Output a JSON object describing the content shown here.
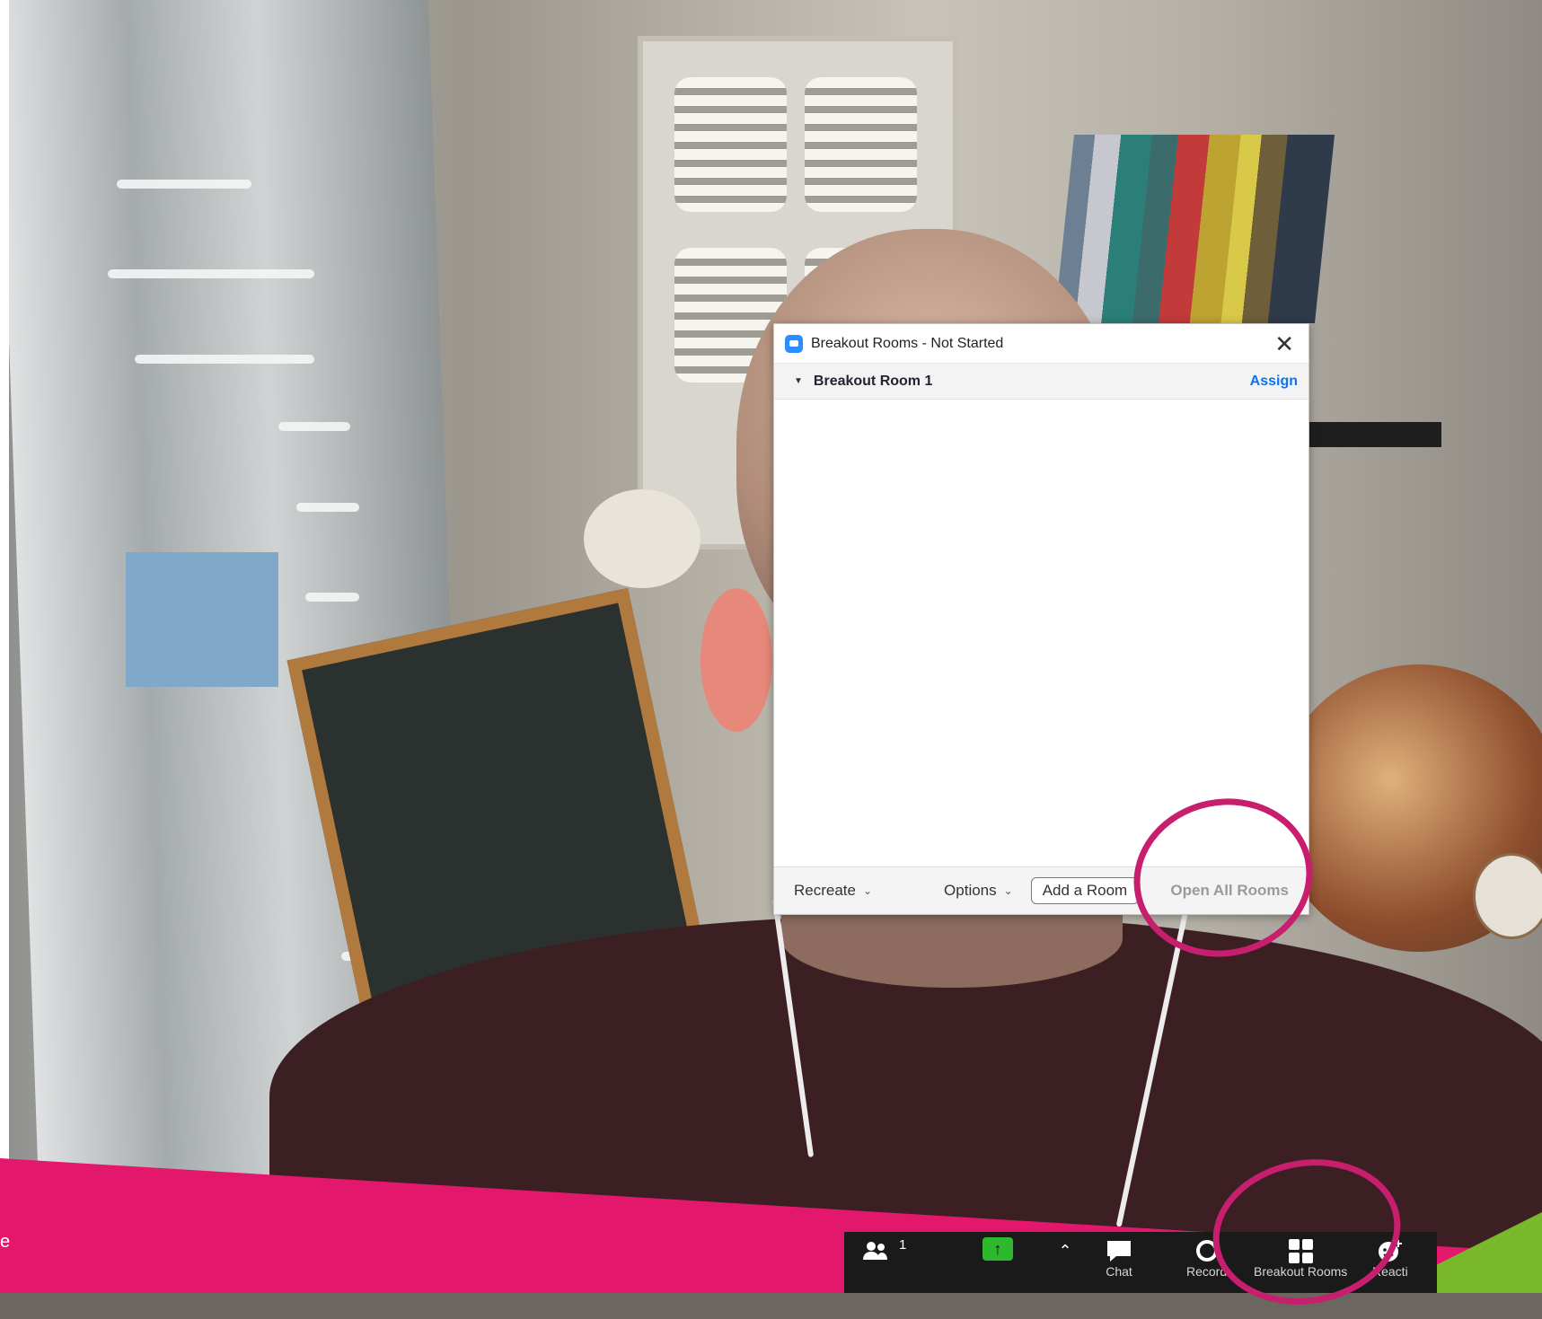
{
  "dialog": {
    "title": "Breakout Rooms - Not Started",
    "room_name": "Breakout Room 1",
    "assign_label": "Assign",
    "recreate_label": "Recreate",
    "options_label": "Options",
    "add_room_label": "Add a Room",
    "open_all_label": "Open All Rooms"
  },
  "toolbar": {
    "participants_count": "1",
    "chat_label": "Chat",
    "record_label": "Record",
    "breakout_label": "Breakout Rooms",
    "reactions_label": "Reacti"
  },
  "slide": {
    "fragment_text": "e"
  },
  "colors": {
    "accent_blue": "#0e72ed",
    "annotation_pink": "#c71f6d",
    "slide_pink": "#e3186c",
    "slide_green": "#79b82a",
    "share_green": "#2eb82e"
  }
}
